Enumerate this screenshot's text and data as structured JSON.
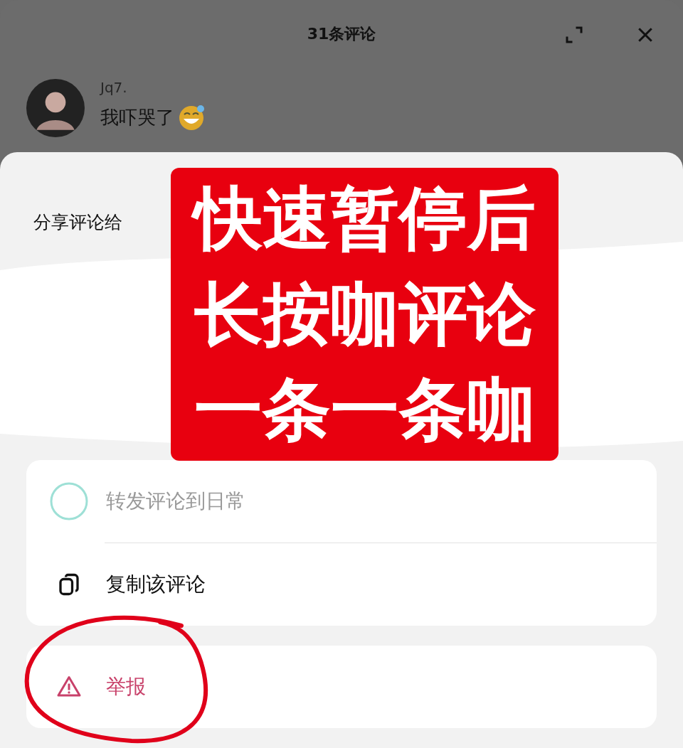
{
  "header": {
    "title": "31条评论"
  },
  "comment": {
    "author": "Jq7.",
    "text": "我吓哭了"
  },
  "share_sheet": {
    "title": "分享评论给"
  },
  "overlay_note": {
    "lines": [
      "快速暂停后",
      "长按咖评论",
      "一条一条咖"
    ]
  },
  "menu_groups": [
    {
      "items": [
        {
          "kind": "repost",
          "label": "转发评论到日常"
        },
        {
          "kind": "copy",
          "label": "复制该评论"
        }
      ]
    },
    {
      "items": [
        {
          "kind": "report",
          "label": "举报"
        }
      ]
    }
  ]
}
